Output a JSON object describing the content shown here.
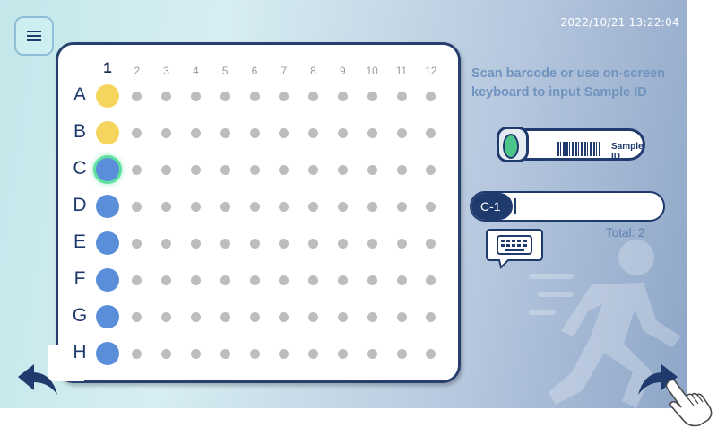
{
  "header": {
    "datetime": "2022/10/21  13:22:04",
    "menu_icon": "hamburger-menu-icon"
  },
  "plate": {
    "columns": [
      "1",
      "2",
      "3",
      "4",
      "5",
      "6",
      "7",
      "8",
      "9",
      "10",
      "11",
      "12"
    ],
    "active_column": "1",
    "rows": [
      {
        "label": "A",
        "state": "assigned",
        "color": "#f6d55e"
      },
      {
        "label": "B",
        "state": "assigned",
        "color": "#f6d55e"
      },
      {
        "label": "C",
        "state": "current",
        "color": "#5a8ed9"
      },
      {
        "label": "D",
        "state": "pending",
        "color": "#5a8ed9"
      },
      {
        "label": "E",
        "state": "pending",
        "color": "#5a8ed9"
      },
      {
        "label": "F",
        "state": "pending",
        "color": "#5a8ed9"
      },
      {
        "label": "G",
        "state": "pending",
        "color": "#5a8ed9"
      },
      {
        "label": "H",
        "state": "pending",
        "color": "#5a8ed9"
      }
    ]
  },
  "scan": {
    "instruction": "Scan barcode or use on-screen keyboard to input Sample ID",
    "tube_label": "Sample ID"
  },
  "sample_input": {
    "well_tag": "C-1",
    "value": ""
  },
  "total": "Total: 2",
  "colors": {
    "accent": "#1f3a6d",
    "highlight": "#5fe09e",
    "assigned": "#f6d55e",
    "pending": "#5a8ed9"
  },
  "icons": {
    "back": "back-arrow-icon",
    "next": "forward-arrow-icon",
    "keyboard": "keyboard-icon",
    "pointer": "hand-pointer-icon"
  }
}
